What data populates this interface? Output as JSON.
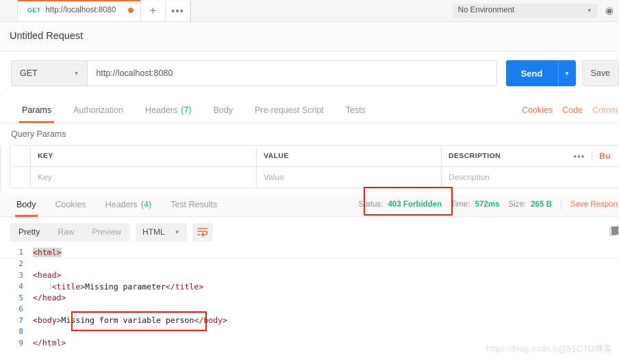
{
  "tabstrip": {
    "request_tab": {
      "method": "GET",
      "url": "http://localhost:8080"
    },
    "new_tab_label": "+",
    "more_label": "•••",
    "environment": {
      "selected": "No Environment",
      "caret": "▼"
    },
    "eye_icon": "◉"
  },
  "request": {
    "name": "Untitled Request",
    "method": "GET",
    "method_caret": "▼",
    "url": "http://localhost:8080",
    "send_label": "Send",
    "send_caret": "▼",
    "save_label": "Save"
  },
  "request_tabs": {
    "items": [
      {
        "label": "Params",
        "count": "",
        "active": true
      },
      {
        "label": "Authorization",
        "count": "",
        "active": false
      },
      {
        "label": "Headers",
        "count": "(7)",
        "active": false
      },
      {
        "label": "Body",
        "count": "",
        "active": false
      },
      {
        "label": "Pre-request Script",
        "count": "",
        "active": false
      },
      {
        "label": "Tests",
        "count": "",
        "active": false
      }
    ],
    "links": [
      {
        "label": "Cookies",
        "dim": false
      },
      {
        "label": "Code",
        "dim": false
      },
      {
        "label": "Comm",
        "dim": true
      }
    ]
  },
  "query_params": {
    "section_title": "Query Params",
    "headers": {
      "key": "KEY",
      "value": "VALUE",
      "description": "DESCRIPTION"
    },
    "row_placeholders": {
      "key": "Key",
      "value": "Value",
      "description": "Description"
    },
    "dots_label": "•••",
    "bulk_edit_label": "Bu"
  },
  "response": {
    "tabs": [
      {
        "label": "Body",
        "count": "",
        "active": true
      },
      {
        "label": "Cookies",
        "count": "",
        "active": false
      },
      {
        "label": "Headers",
        "count": "(4)",
        "active": false
      },
      {
        "label": "Test Results",
        "count": "",
        "active": false
      }
    ],
    "status_label": "Status:",
    "status_value": "403 Forbidden",
    "time_label": "Time:",
    "time_value": "572ms",
    "size_label": "Size:",
    "size_value": "265 B",
    "save_response_label": "Save Respon"
  },
  "viewbar": {
    "modes": [
      {
        "label": "Pretty",
        "active": true
      },
      {
        "label": "Raw",
        "active": false
      },
      {
        "label": "Preview",
        "active": false
      }
    ],
    "format": "HTML",
    "format_caret": "▼",
    "wrap_icon": "⇥"
  },
  "code": {
    "lines": [
      {
        "n": "1",
        "segments": [
          {
            "t": "<html>",
            "c": "sel"
          }
        ]
      },
      {
        "n": "2",
        "segments": []
      },
      {
        "n": "3",
        "segments": [
          {
            "t": "<head>",
            "c": "tg"
          }
        ]
      },
      {
        "n": "4",
        "segments": [
          {
            "t": "    <title>",
            "c": "tg"
          },
          {
            "t": "Missing parameter",
            "c": "txt"
          },
          {
            "t": "</title>",
            "c": "tg"
          }
        ]
      },
      {
        "n": "5",
        "segments": [
          {
            "t": "</head>",
            "c": "tg"
          }
        ]
      },
      {
        "n": "6",
        "segments": []
      },
      {
        "n": "7",
        "segments": [
          {
            "t": "<body>",
            "c": "tg"
          },
          {
            "t": "Missing form variable person",
            "c": "txt"
          },
          {
            "t": "</body>",
            "c": "tg"
          }
        ]
      },
      {
        "n": "8",
        "segments": []
      },
      {
        "n": "9",
        "segments": [
          {
            "t": "</html>",
            "c": "tg"
          }
        ]
      }
    ]
  },
  "watermark": {
    "url": "https://blog.csdn.n",
    "suffix": "@51CTO博客"
  },
  "colors": {
    "accent_orange": "#f26b3a",
    "send_blue": "#1a7ded",
    "status_green": "#1eb980",
    "annotation_red": "#f11d1d",
    "method_green": "#2aae7f"
  }
}
